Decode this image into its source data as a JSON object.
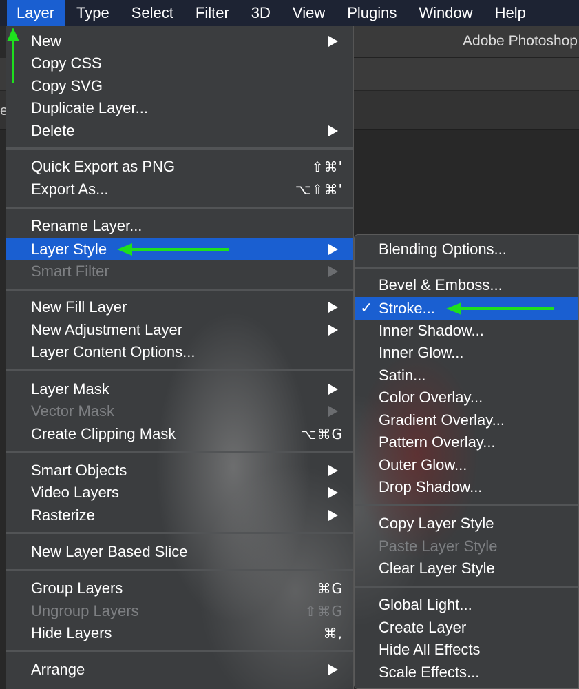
{
  "menubar": {
    "items": [
      "Layer",
      "Type",
      "Select",
      "Filter",
      "3D",
      "View",
      "Plugins",
      "Window",
      "Help"
    ]
  },
  "app": {
    "title": "Adobe Photoshop"
  },
  "tab_edge_text": "e",
  "layer_menu": {
    "new": "New",
    "copy_css": "Copy CSS",
    "copy_svg": "Copy SVG",
    "duplicate_layer": "Duplicate Layer...",
    "delete": "Delete",
    "quick_export": "Quick Export as PNG",
    "quick_export_sc": "⇧⌘'",
    "export_as": "Export As...",
    "export_as_sc": "⌥⇧⌘'",
    "rename_layer": "Rename Layer...",
    "layer_style": "Layer Style",
    "smart_filter": "Smart Filter",
    "new_fill_layer": "New Fill Layer",
    "new_adjustment_layer": "New Adjustment Layer",
    "layer_content_options": "Layer Content Options...",
    "layer_mask": "Layer Mask",
    "vector_mask": "Vector Mask",
    "create_clipping_mask": "Create Clipping Mask",
    "create_clipping_mask_sc": "⌥⌘G",
    "smart_objects": "Smart Objects",
    "video_layers": "Video Layers",
    "rasterize": "Rasterize",
    "new_layer_based_slice": "New Layer Based Slice",
    "group_layers": "Group Layers",
    "group_layers_sc": "⌘G",
    "ungroup_layers": "Ungroup Layers",
    "ungroup_layers_sc": "⇧⌘G",
    "hide_layers": "Hide Layers",
    "hide_layers_sc": "⌘,",
    "arrange": "Arrange"
  },
  "layer_style_submenu": {
    "blending_options": "Blending Options...",
    "bevel_emboss": "Bevel & Emboss...",
    "stroke": "Stroke...",
    "stroke_check": "✓",
    "inner_shadow": "Inner Shadow...",
    "inner_glow": "Inner Glow...",
    "satin": "Satin...",
    "color_overlay": "Color Overlay...",
    "gradient_overlay": "Gradient Overlay...",
    "pattern_overlay": "Pattern Overlay...",
    "outer_glow": "Outer Glow...",
    "drop_shadow": "Drop Shadow...",
    "copy_layer_style": "Copy Layer Style",
    "paste_layer_style": "Paste Layer Style",
    "clear_layer_style": "Clear Layer Style",
    "global_light": "Global Light...",
    "create_layer": "Create Layer",
    "hide_all_effects": "Hide All Effects",
    "scale_effects": "Scale Effects..."
  },
  "colors": {
    "highlight": "#1a5fd1",
    "annotation_arrow": "#1ee01e",
    "menubar_bg": "#1d2333",
    "menu_bg": "#3b3d3f"
  }
}
